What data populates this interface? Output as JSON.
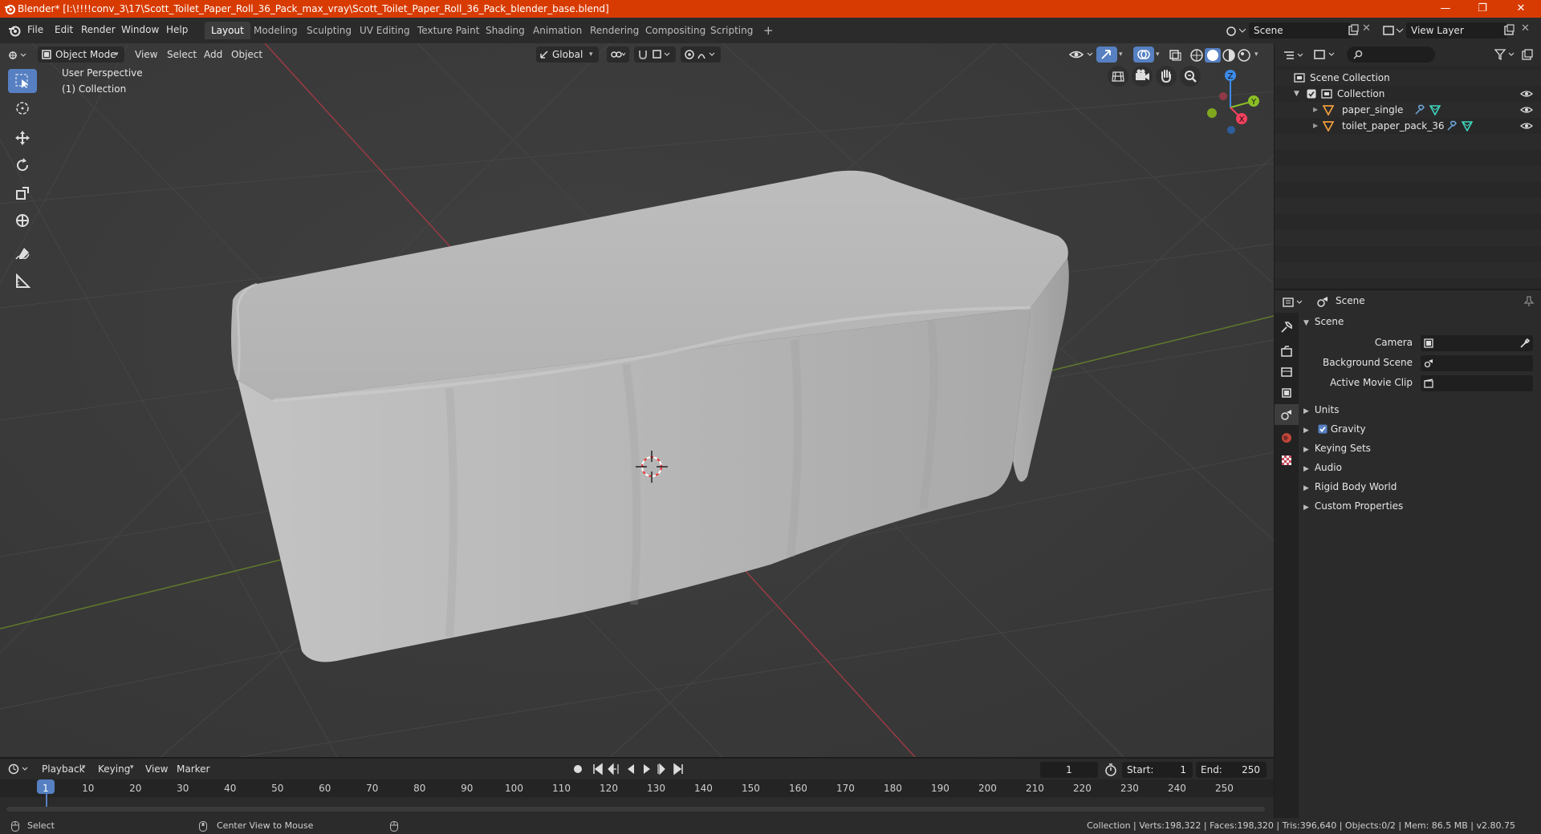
{
  "window": {
    "title": "Blender* [I:\\!!!!conv_3\\17\\Scott_Toilet_Paper_Roll_36_Pack_max_vray\\Scott_Toilet_Paper_Roll_36_Pack_blender_base.blend]",
    "minimize": "—",
    "maximize": "❐",
    "close": "✕",
    "bar_color": "#d83b01"
  },
  "menus": [
    "File",
    "Edit",
    "Render",
    "Window",
    "Help"
  ],
  "workspaces": [
    "Layout",
    "Modeling",
    "Sculpting",
    "UV Editing",
    "Texture Paint",
    "Shading",
    "Animation",
    "Rendering",
    "Compositing",
    "Scripting"
  ],
  "active_workspace": "Layout",
  "add_workspace": "+",
  "scene_selector": "Scene",
  "view_layer_selector": "View Layer",
  "viewport_header": {
    "mode": "Object Mode",
    "view": "View",
    "select": "Select",
    "add": "Add",
    "object": "Object",
    "orientation": "Global"
  },
  "viewport_overlay": {
    "perspective": "User Perspective",
    "collection": "(1) Collection"
  },
  "gizmo": {
    "z": "Z",
    "y": "Y",
    "x": "X",
    "x_color": "#f5415e",
    "y_color": "#8cbf26",
    "z_color": "#3c8be8"
  },
  "outliner": {
    "search_placeholder": "",
    "scene_collection": "Scene Collection",
    "collection": "Collection",
    "objects": [
      "paper_single",
      "toilet_paper_pack_36"
    ]
  },
  "properties": {
    "header_title": "Scene",
    "panel_title": "Scene",
    "camera_label": "Camera",
    "background_scene_label": "Background Scene",
    "active_movie_clip_label": "Active Movie Clip",
    "subpanels": [
      "Units",
      "Gravity",
      "Keying Sets",
      "Audio",
      "Rigid Body World",
      "Custom Properties"
    ],
    "gravity_checked": true
  },
  "timeline": {
    "playback": "Playback",
    "keying": "Keying",
    "view": "View",
    "marker": "Marker",
    "current_frame": "1",
    "start_label": "Start:",
    "start_value": "1",
    "end_label": "End:",
    "end_value": "250",
    "ruler_ticks": [
      "1",
      "10",
      "20",
      "30",
      "40",
      "50",
      "60",
      "70",
      "80",
      "90",
      "100",
      "110",
      "120",
      "130",
      "140",
      "150",
      "160",
      "170",
      "180",
      "190",
      "200",
      "210",
      "220",
      "230",
      "240",
      "250"
    ]
  },
  "statusbar": {
    "select": "Select",
    "center_view": "Center View to Mouse",
    "stats": "Collection | Verts:198,322 | Faces:198,320 | Tris:396,640 | Objects:0/2 | Mem: 86.5 MB | v2.80.75"
  }
}
